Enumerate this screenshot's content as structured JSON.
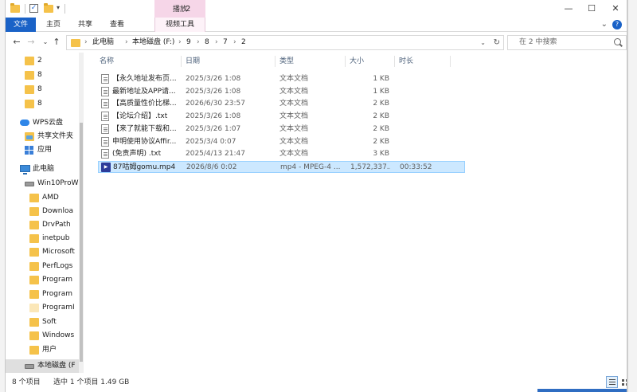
{
  "window": {
    "title": "2",
    "context_group": "播放",
    "minimize": "—",
    "maximize": "☐",
    "close": "✕"
  },
  "ribbon": {
    "tabs": [
      "文件",
      "主页",
      "共享",
      "查看",
      "视频工具"
    ],
    "help": "?"
  },
  "address": {
    "crumbs": [
      "此电脑",
      "本地磁盘 (F:)",
      "9",
      "8",
      "7",
      "2"
    ],
    "search_placeholder": "在 2 中搜索"
  },
  "sidebar": {
    "top_folders": [
      "2",
      "8",
      "8",
      "8"
    ],
    "wps": "WPS云盘",
    "shared": "共享文件夹",
    "apps": "应用",
    "this_pc": "此电脑",
    "drive_c": "Win10ProW",
    "c_folders": [
      "AMD",
      "Downloa",
      "DrvPath",
      "inetpub",
      "Microsoft",
      "PerfLogs",
      "Program",
      "Program",
      "ProgramI",
      "Soft",
      "Windows",
      "用户"
    ],
    "drive_f": "本地磁盘 (F"
  },
  "columns": {
    "name": "名称",
    "date": "日期",
    "type": "类型",
    "size": "大小",
    "duration": "时长"
  },
  "files": [
    {
      "name": "【永久地址发布页...",
      "date": "2025/3/26 1:08",
      "type": "文本文档",
      "size": "1 KB",
      "duration": "",
      "icon": "txt"
    },
    {
      "name": "最新地址及APP请...",
      "date": "2025/3/26 1:08",
      "type": "文本文档",
      "size": "1 KB",
      "duration": "",
      "icon": "txt"
    },
    {
      "name": "【高质量性价比梯...",
      "date": "2026/6/30 23:57",
      "type": "文本文档",
      "size": "2 KB",
      "duration": "",
      "icon": "txt"
    },
    {
      "name": "【论坛介绍】.txt",
      "date": "2025/3/26 1:08",
      "type": "文本文档",
      "size": "2 KB",
      "duration": "",
      "icon": "txt"
    },
    {
      "name": "【来了就能下载和...",
      "date": "2025/3/26 1:07",
      "type": "文本文档",
      "size": "2 KB",
      "duration": "",
      "icon": "txt"
    },
    {
      "name": "申明使用协议Affir...",
      "date": "2025/3/4 0:07",
      "type": "文本文档",
      "size": "2 KB",
      "duration": "",
      "icon": "txt"
    },
    {
      "name": "(免责声明) .txt",
      "date": "2025/4/13 21:47",
      "type": "文本文档",
      "size": "3 KB",
      "duration": "",
      "icon": "txt"
    },
    {
      "name": "87咕姆gomu.mp4",
      "date": "2026/8/6 0:02",
      "type": "mp4 - MPEG-4 ...",
      "size": "1,572,337...",
      "duration": "00:33:52",
      "icon": "mp4",
      "selected": true
    }
  ],
  "status": {
    "count": "8 个项目",
    "selection": "选中 1 个项目  1.49 GB"
  }
}
